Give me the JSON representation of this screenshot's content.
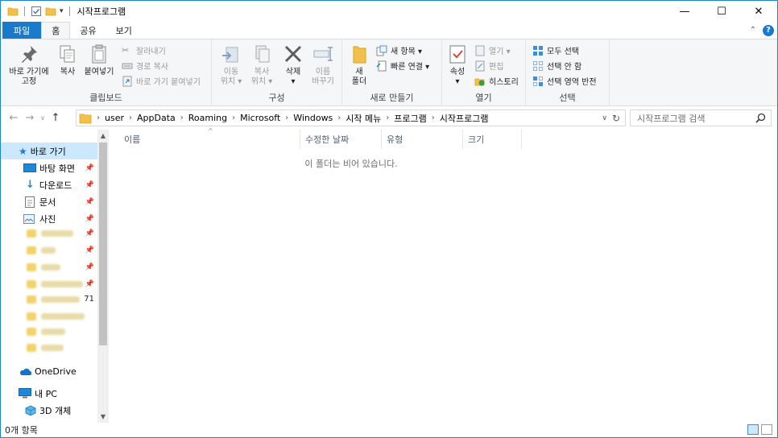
{
  "window": {
    "title": "시작프로그램",
    "minimize": "—",
    "maximize": "☐",
    "close": "✕"
  },
  "tabs": {
    "file": "파일",
    "home": "홈",
    "share": "공유",
    "view": "보기"
  },
  "ribbon": {
    "clipboard": {
      "label": "클립보드",
      "pin": "바로 가기에\n고정",
      "copy": "복사",
      "paste": "붙여넣기",
      "cut": "잘라내기",
      "copy_path": "경로 복사",
      "paste_shortcut": "바로 가기 붙여넣기"
    },
    "organize": {
      "label": "구성",
      "move_to": "이동\n위치 ▾",
      "copy_to": "복사\n위치 ▾",
      "delete": "삭제\n▾",
      "rename": "이름\n바꾸기"
    },
    "new": {
      "label": "새로 만들기",
      "new_folder": "새\n폴더",
      "new_item": "새 항목 ▾",
      "easy_access": "빠른 연결 ▾"
    },
    "open": {
      "label": "열기",
      "properties": "속성\n▾",
      "open": "열기 ▾",
      "edit": "편집",
      "history": "히스토리"
    },
    "select": {
      "label": "선택",
      "select_all": "모두 선택",
      "select_none": "선택 안 함",
      "invert": "선택 영역 반전"
    }
  },
  "address": {
    "crumbs": [
      "user",
      "AppData",
      "Roaming",
      "Microsoft",
      "Windows",
      "시작 메뉴",
      "프로그램",
      "시작프로그램"
    ],
    "search_placeholder": "시작프로그램 검색"
  },
  "nav": {
    "quick_access": "바로 가기",
    "desktop": "바탕 화면",
    "downloads": "다운로드",
    "documents": "문서",
    "pictures": "사진",
    "blurred_badge": "71",
    "onedrive": "OneDrive",
    "this_pc": "내 PC",
    "objects3d": "3D 개체"
  },
  "columns": {
    "name": "이름",
    "date": "수정한 날짜",
    "type": "유형",
    "size": "크기"
  },
  "content": {
    "empty_message": "이 폴더는 비어 있습니다."
  },
  "status": {
    "count": "0개 항목"
  },
  "colors": {
    "accent": "#1979ca",
    "selection": "#cce8ff",
    "folder": "#f3c14b"
  }
}
